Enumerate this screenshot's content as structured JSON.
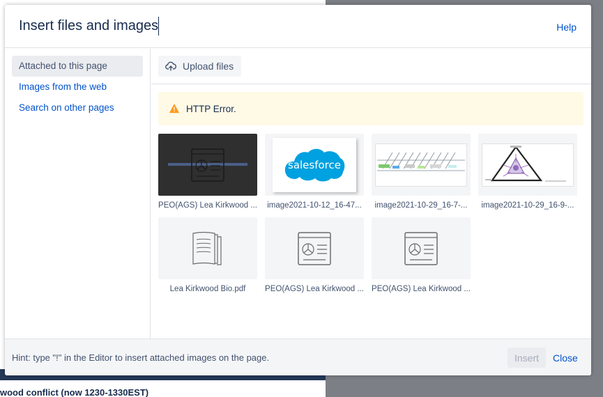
{
  "background": {
    "text": "wood conflict (now 1230-1330EST)"
  },
  "dialog": {
    "title": "Insert files and images",
    "help_label": "Help"
  },
  "sidebar": {
    "items": [
      {
        "label": "Attached to this page",
        "active": true
      },
      {
        "label": "Images from the web",
        "active": false
      },
      {
        "label": "Search on other pages",
        "active": false
      }
    ]
  },
  "toolbar": {
    "upload_label": "Upload files",
    "upload_icon": "cloud-upload-icon"
  },
  "error": {
    "icon": "warning-icon",
    "message": "HTTP Error."
  },
  "files": [
    {
      "caption": "PEO(AGS) Lea Kirkwood ...",
      "thumb": "image-placeholder-icon",
      "style": "dark"
    },
    {
      "caption": "image2021-10-12_16-47...",
      "thumb": "salesforce-logo",
      "style": "salesforce"
    },
    {
      "caption": "image2021-10-29_16-7-...",
      "thumb": "timeline-screenshot",
      "style": "timeline"
    },
    {
      "caption": "image2021-10-29_16-9-...",
      "thumb": "triangle-diagram",
      "style": "triangle"
    },
    {
      "caption": "Lea Kirkwood Bio.pdf",
      "thumb": "document-icon",
      "style": "doc"
    },
    {
      "caption": "PEO(AGS) Lea Kirkwood ...",
      "thumb": "image-placeholder-icon",
      "style": "placeholder"
    },
    {
      "caption": "PEO(AGS) Lea Kirkwood ...",
      "thumb": "image-placeholder-icon",
      "style": "placeholder"
    }
  ],
  "logos": {
    "salesforce_text": "salesforce"
  },
  "footer": {
    "hint": "Hint: type \"!\" in the Editor to insert attached images on the page.",
    "insert_label": "Insert",
    "close_label": "Close"
  },
  "colors": {
    "link": "#0052cc",
    "warning": "#ff991f",
    "error_bg": "#fffae6",
    "salesforce": "#00a1e0"
  }
}
